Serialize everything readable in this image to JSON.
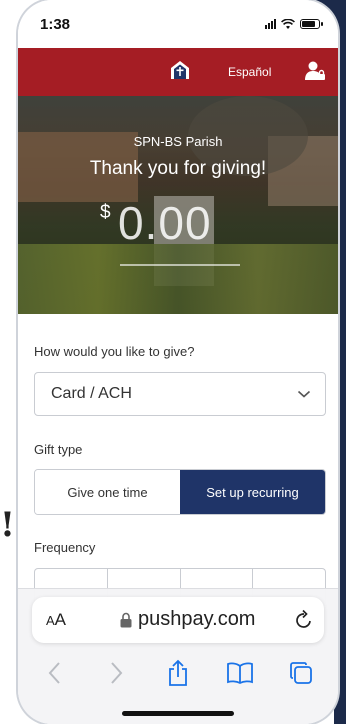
{
  "status_bar": {
    "time": "1:38"
  },
  "header": {
    "language_link": "Español",
    "brand_color": "#a51d24",
    "logo_icon": "church-door-icon",
    "account_icon": "user-lock-icon"
  },
  "hero": {
    "parish_name": "SPN-BS Parish",
    "thank_you": "Thank you for giving!",
    "currency_symbol": "$",
    "amount": "0.00"
  },
  "form": {
    "give_question": "How would you like to give?",
    "payment_method": "Card / ACH",
    "gift_type_label": "Gift type",
    "gift_type_options": [
      {
        "label": "Give one time",
        "selected": false
      },
      {
        "label": "Set up recurring",
        "selected": true
      }
    ],
    "frequency_label": "Frequency",
    "accent_color": "#1f3468"
  },
  "browser": {
    "text_size_label_big": "A",
    "text_size_label_small": "A",
    "url": "pushpay.com",
    "toolbar_icons": [
      "back-icon",
      "forward-icon",
      "share-icon",
      "bookmarks-icon",
      "tabs-icon"
    ],
    "toolbar_color": "#1a73e8"
  },
  "background": {
    "note_text": "!"
  }
}
